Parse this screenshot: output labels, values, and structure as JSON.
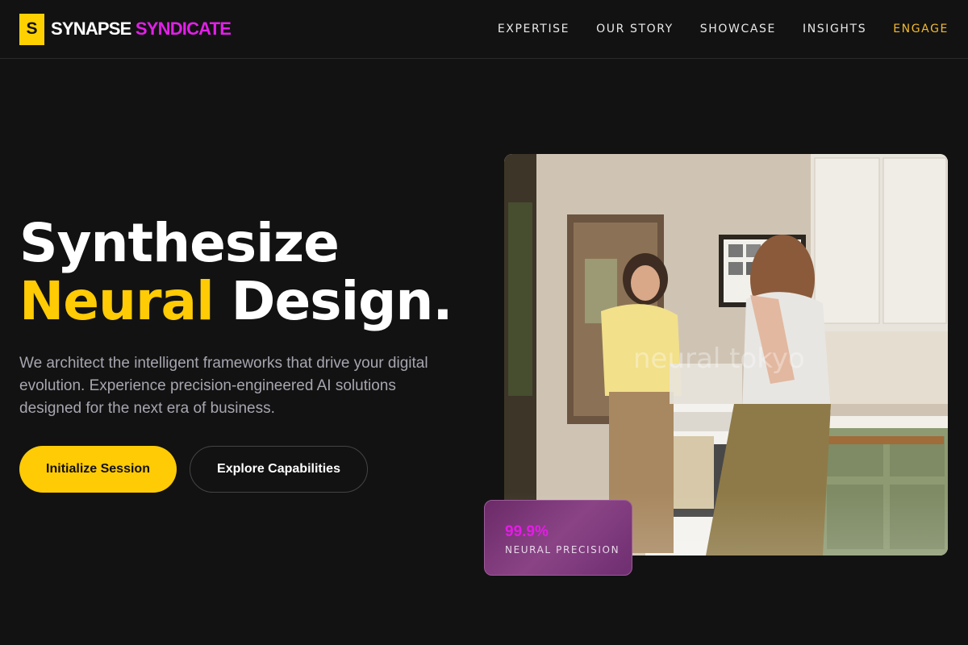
{
  "brand": {
    "mark": "S",
    "name_part1": "SYNAPSE",
    "name_part2": "SYNDICATE"
  },
  "nav": {
    "items": [
      {
        "label": "EXPERTISE"
      },
      {
        "label": "OUR STORY"
      },
      {
        "label": "SHOWCASE"
      },
      {
        "label": "INSIGHTS"
      },
      {
        "label": "ENGAGE"
      }
    ]
  },
  "hero": {
    "title_line1": "Synthesize",
    "title_highlight": "Neural",
    "title_rest": " Design.",
    "description": "We architect the intelligent frameworks that drive your digital evolution. Experience precision-engineered AI solutions designed for the next era of business.",
    "primary_cta": "Initialize Session",
    "secondary_cta": "Explore Capabilities"
  },
  "stat": {
    "value": "99.9%",
    "label": "NEURAL PRECISION"
  },
  "photo": {
    "watermark": "neural tokyo"
  },
  "colors": {
    "background": "#121212",
    "accent_yellow": "#ffcb05",
    "accent_magenta": "#e21fe8",
    "nav_engage": "#f2b92f"
  }
}
